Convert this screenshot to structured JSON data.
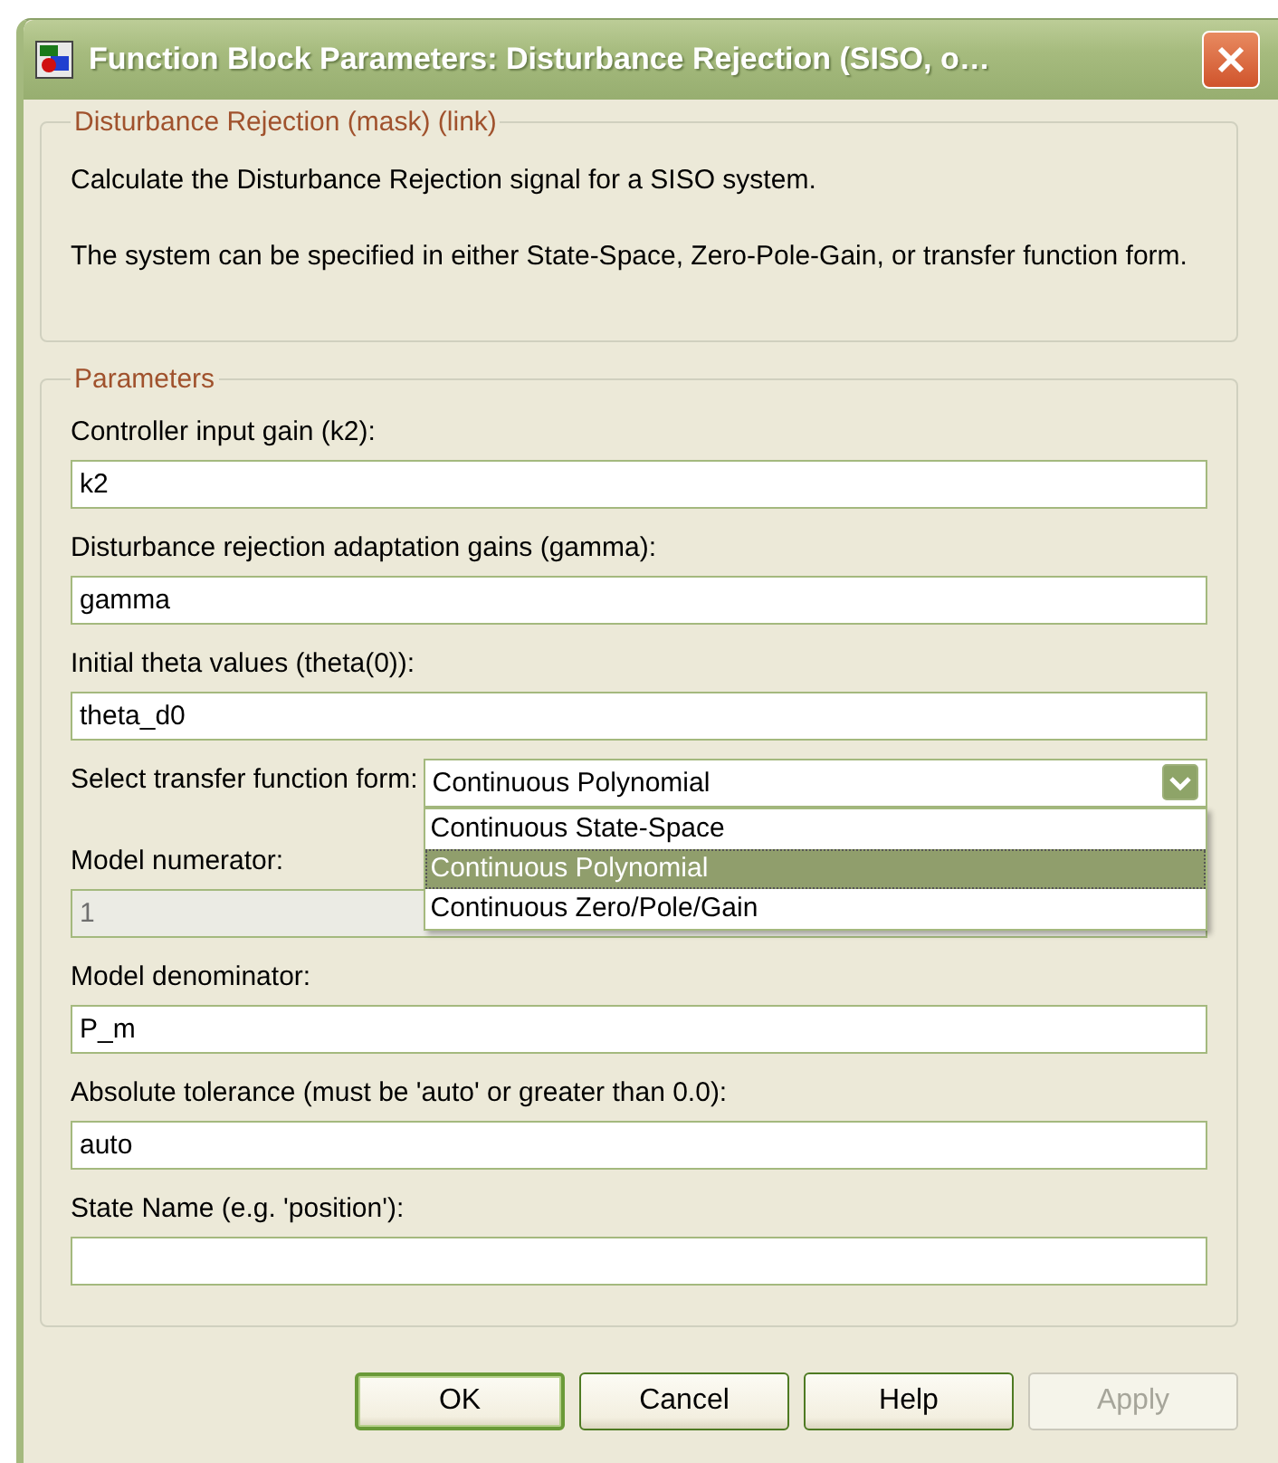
{
  "window": {
    "title": "Function Block Parameters: Disturbance Rejection (SISO, o…"
  },
  "description": {
    "title": "Disturbance Rejection (mask) (link)",
    "paragraphs": [
      "Calculate the Disturbance Rejection signal for a SISO system.",
      "The system can be specified in either State-Space, Zero-Pole-Gain, or transfer function form."
    ]
  },
  "parameters": {
    "title": "Parameters",
    "fields": [
      {
        "kind": "text",
        "label": "Controller input gain (k2):",
        "value": "k2",
        "disabled": false
      },
      {
        "kind": "text",
        "label": "Disturbance rejection adaptation gains (gamma):",
        "value": "gamma",
        "disabled": false
      },
      {
        "kind": "text",
        "label": "Initial theta values (theta(0)):",
        "value": "theta_d0",
        "disabled": false
      },
      {
        "kind": "select",
        "label": "Select transfer function form:",
        "value": "Continuous Polynomial",
        "expanded": true,
        "options": [
          {
            "label": "Continuous State-Space",
            "selected": false
          },
          {
            "label": "Continuous Polynomial",
            "selected": true
          },
          {
            "label": "Continuous Zero/Pole/Gain",
            "selected": false
          }
        ]
      },
      {
        "kind": "text",
        "label": "Model numerator:",
        "value": "1",
        "disabled": true
      },
      {
        "kind": "text",
        "label": "Model denominator:",
        "value": "P_m",
        "disabled": false
      },
      {
        "kind": "text",
        "label": "Absolute tolerance (must be 'auto' or greater than 0.0):",
        "value": "auto",
        "disabled": false
      },
      {
        "kind": "text",
        "label": "State Name (e.g. 'position'):",
        "disabled": false
      }
    ]
  },
  "buttons": [
    {
      "label": "OK",
      "default": true,
      "disabled": false
    },
    {
      "label": "Cancel",
      "default": false,
      "disabled": false
    },
    {
      "label": "Help",
      "default": false,
      "disabled": false
    },
    {
      "label": "Apply",
      "default": false,
      "disabled": true
    }
  ]
}
